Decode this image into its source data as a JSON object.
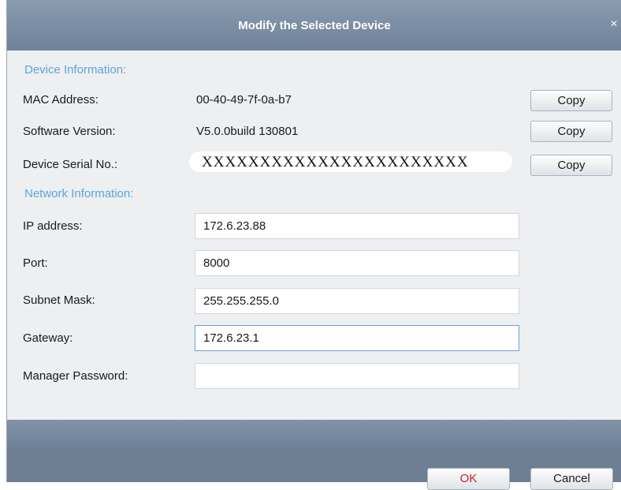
{
  "dialog": {
    "title": "Modify the Selected Device",
    "close_glyph": "×"
  },
  "device_info": {
    "section_title": "Device Information:",
    "mac_label": "MAC Address:",
    "mac_value": "00-40-49-7f-0a-b7",
    "software_label": "Software Version:",
    "software_value": "V5.0.0build 130801",
    "serial_label": "Device Serial No.:",
    "serial_value": "XXXXXXXXXXXXXXXXXXXXXXX",
    "copy_label": "Copy"
  },
  "network_info": {
    "section_title": "Network Information:",
    "ip_label": "IP address:",
    "ip_value": "172.6.23.88",
    "port_label": "Port:",
    "port_value": "8000",
    "subnet_label": "Subnet Mask:",
    "subnet_value": "255.255.255.0",
    "gateway_label": "Gateway:",
    "gateway_value": "172.6.23.1",
    "password_label": "Manager Password:",
    "password_value": ""
  },
  "buttons": {
    "ok": "OK",
    "cancel": "Cancel"
  },
  "colors": {
    "section_title": "#5aa6d8",
    "ok_text": "#c0262d",
    "titlebar": "#7d8fa5"
  }
}
